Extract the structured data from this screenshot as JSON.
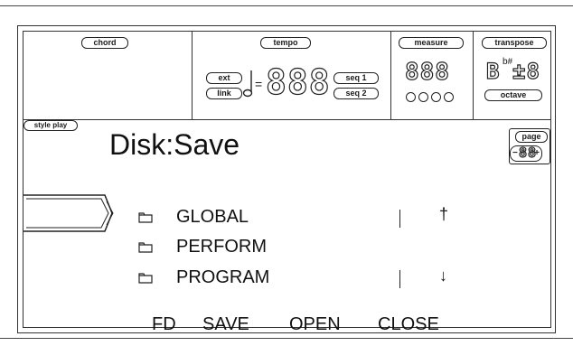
{
  "header": {
    "chord_label": "chord",
    "tempo_label": "tempo",
    "tempo_ext": "ext",
    "tempo_link": "link",
    "tempo_eq": "=",
    "tempo_value": "888",
    "tempo_seq1": "seq 1",
    "tempo_seq2": "seq 2",
    "measure_label": "measure",
    "measure_value": "888",
    "transpose_label": "transpose",
    "transpose_key": "B",
    "transpose_accidental": "b#",
    "transpose_value": "±8",
    "octave_label": "octave"
  },
  "mode": {
    "label": "style play",
    "title": "Disk:Save"
  },
  "page": {
    "label": "page",
    "value": "88"
  },
  "folders": [
    {
      "name": "GLOBAL"
    },
    {
      "name": "PERFORM"
    },
    {
      "name": "PROGRAM"
    }
  ],
  "scroll": {
    "up": "†",
    "down": "↓"
  },
  "commands": [
    "FD",
    "SAVE",
    "OPEN",
    "CLOSE"
  ]
}
